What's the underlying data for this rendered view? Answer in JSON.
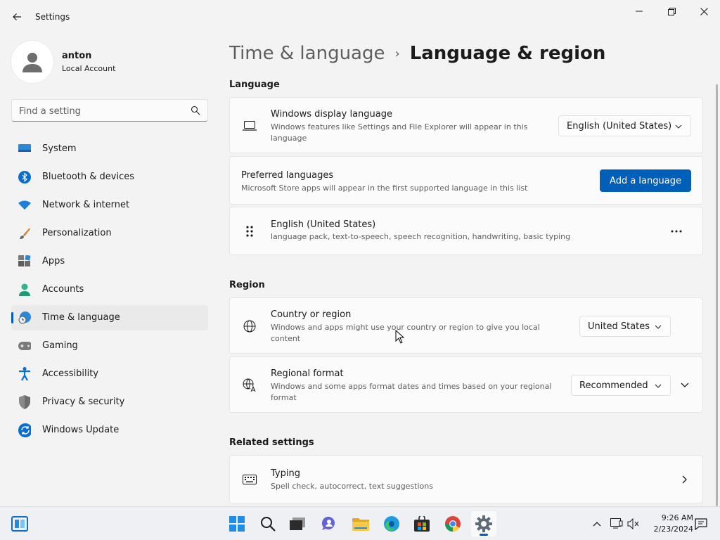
{
  "window": {
    "app_title": "Settings",
    "minimize_icon": "minimize-icon",
    "maximize_icon": "restore-icon",
    "close_icon": "close-icon"
  },
  "profile": {
    "name": "anton",
    "account_type": "Local Account"
  },
  "search": {
    "placeholder": "Find a setting",
    "value": ""
  },
  "sidebar": {
    "items": [
      {
        "label": "System",
        "icon": "monitor-icon"
      },
      {
        "label": "Bluetooth & devices",
        "icon": "bluetooth-icon"
      },
      {
        "label": "Network & internet",
        "icon": "wifi-icon"
      },
      {
        "label": "Personalization",
        "icon": "brush-icon"
      },
      {
        "label": "Apps",
        "icon": "apps-icon"
      },
      {
        "label": "Accounts",
        "icon": "person-icon"
      },
      {
        "label": "Time & language",
        "icon": "clock-globe-icon",
        "selected": true
      },
      {
        "label": "Gaming",
        "icon": "gamepad-icon"
      },
      {
        "label": "Accessibility",
        "icon": "accessibility-icon"
      },
      {
        "label": "Privacy & security",
        "icon": "shield-icon"
      },
      {
        "label": "Windows Update",
        "icon": "update-icon"
      }
    ]
  },
  "breadcrumb": {
    "parent": "Time & language",
    "separator": "›",
    "current": "Language & region"
  },
  "language": {
    "section_title": "Language",
    "display_language": {
      "title": "Windows display language",
      "description": "Windows features like Settings and File Explorer will appear in this language",
      "value": "English (United States)"
    },
    "preferred": {
      "title": "Preferred languages",
      "description": "Microsoft Store apps will appear in the first supported language in this list",
      "button_label": "Add a language"
    },
    "installed": [
      {
        "title": "English (United States)",
        "description": "language pack, text-to-speech, speech recognition, handwriting, basic typing"
      }
    ]
  },
  "region": {
    "section_title": "Region",
    "country": {
      "title": "Country or region",
      "description": "Windows and apps might use your country or region to give you local content",
      "value": "United States"
    },
    "format": {
      "title": "Regional format",
      "description": "Windows and some apps format dates and times based on your regional format",
      "value": "Recommended"
    }
  },
  "related": {
    "section_title": "Related settings",
    "typing": {
      "title": "Typing",
      "description": "Spell check, autocorrect, text suggestions"
    }
  },
  "taskbar": {
    "apps": [
      "start-icon",
      "search-icon",
      "task-view-icon",
      "chat-icon",
      "file-explorer-icon",
      "edge-icon",
      "store-icon",
      "chrome-icon",
      "settings-icon"
    ],
    "time": "9:26 AM",
    "date": "2/23/2024"
  },
  "colors": {
    "accent": "#005fb8",
    "background": "#f3f3f3",
    "card": "#fbfbfb"
  }
}
